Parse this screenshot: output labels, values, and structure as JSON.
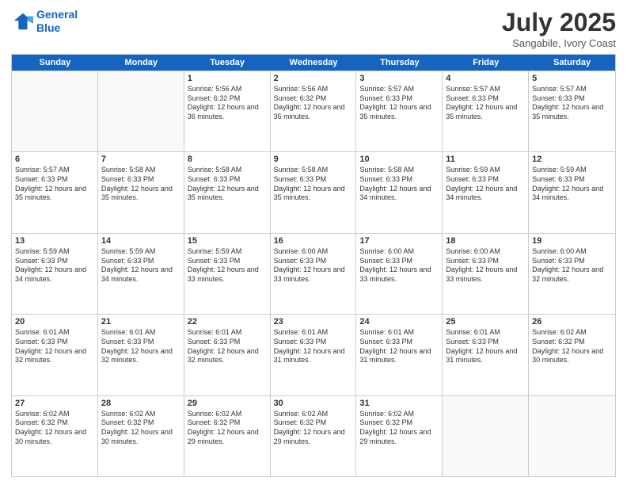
{
  "header": {
    "logo_line1": "General",
    "logo_line2": "Blue",
    "month_title": "July 2025",
    "location": "Sangabile, Ivory Coast"
  },
  "days_of_week": [
    "Sunday",
    "Monday",
    "Tuesday",
    "Wednesday",
    "Thursday",
    "Friday",
    "Saturday"
  ],
  "weeks": [
    [
      {
        "day": "",
        "empty": true
      },
      {
        "day": "",
        "empty": true
      },
      {
        "day": "1",
        "sunrise": "Sunrise: 5:56 AM",
        "sunset": "Sunset: 6:32 PM",
        "daylight": "Daylight: 12 hours and 36 minutes."
      },
      {
        "day": "2",
        "sunrise": "Sunrise: 5:56 AM",
        "sunset": "Sunset: 6:32 PM",
        "daylight": "Daylight: 12 hours and 35 minutes."
      },
      {
        "day": "3",
        "sunrise": "Sunrise: 5:57 AM",
        "sunset": "Sunset: 6:33 PM",
        "daylight": "Daylight: 12 hours and 35 minutes."
      },
      {
        "day": "4",
        "sunrise": "Sunrise: 5:57 AM",
        "sunset": "Sunset: 6:33 PM",
        "daylight": "Daylight: 12 hours and 35 minutes."
      },
      {
        "day": "5",
        "sunrise": "Sunrise: 5:57 AM",
        "sunset": "Sunset: 6:33 PM",
        "daylight": "Daylight: 12 hours and 35 minutes."
      }
    ],
    [
      {
        "day": "6",
        "sunrise": "Sunrise: 5:57 AM",
        "sunset": "Sunset: 6:33 PM",
        "daylight": "Daylight: 12 hours and 35 minutes."
      },
      {
        "day": "7",
        "sunrise": "Sunrise: 5:58 AM",
        "sunset": "Sunset: 6:33 PM",
        "daylight": "Daylight: 12 hours and 35 minutes."
      },
      {
        "day": "8",
        "sunrise": "Sunrise: 5:58 AM",
        "sunset": "Sunset: 6:33 PM",
        "daylight": "Daylight: 12 hours and 35 minutes."
      },
      {
        "day": "9",
        "sunrise": "Sunrise: 5:58 AM",
        "sunset": "Sunset: 6:33 PM",
        "daylight": "Daylight: 12 hours and 35 minutes."
      },
      {
        "day": "10",
        "sunrise": "Sunrise: 5:58 AM",
        "sunset": "Sunset: 6:33 PM",
        "daylight": "Daylight: 12 hours and 34 minutes."
      },
      {
        "day": "11",
        "sunrise": "Sunrise: 5:59 AM",
        "sunset": "Sunset: 6:33 PM",
        "daylight": "Daylight: 12 hours and 34 minutes."
      },
      {
        "day": "12",
        "sunrise": "Sunrise: 5:59 AM",
        "sunset": "Sunset: 6:33 PM",
        "daylight": "Daylight: 12 hours and 34 minutes."
      }
    ],
    [
      {
        "day": "13",
        "sunrise": "Sunrise: 5:59 AM",
        "sunset": "Sunset: 6:33 PM",
        "daylight": "Daylight: 12 hours and 34 minutes."
      },
      {
        "day": "14",
        "sunrise": "Sunrise: 5:59 AM",
        "sunset": "Sunset: 6:33 PM",
        "daylight": "Daylight: 12 hours and 34 minutes."
      },
      {
        "day": "15",
        "sunrise": "Sunrise: 5:59 AM",
        "sunset": "Sunset: 6:33 PM",
        "daylight": "Daylight: 12 hours and 33 minutes."
      },
      {
        "day": "16",
        "sunrise": "Sunrise: 6:00 AM",
        "sunset": "Sunset: 6:33 PM",
        "daylight": "Daylight: 12 hours and 33 minutes."
      },
      {
        "day": "17",
        "sunrise": "Sunrise: 6:00 AM",
        "sunset": "Sunset: 6:33 PM",
        "daylight": "Daylight: 12 hours and 33 minutes."
      },
      {
        "day": "18",
        "sunrise": "Sunrise: 6:00 AM",
        "sunset": "Sunset: 6:33 PM",
        "daylight": "Daylight: 12 hours and 33 minutes."
      },
      {
        "day": "19",
        "sunrise": "Sunrise: 6:00 AM",
        "sunset": "Sunset: 6:33 PM",
        "daylight": "Daylight: 12 hours and 32 minutes."
      }
    ],
    [
      {
        "day": "20",
        "sunrise": "Sunrise: 6:01 AM",
        "sunset": "Sunset: 6:33 PM",
        "daylight": "Daylight: 12 hours and 32 minutes."
      },
      {
        "day": "21",
        "sunrise": "Sunrise: 6:01 AM",
        "sunset": "Sunset: 6:33 PM",
        "daylight": "Daylight: 12 hours and 32 minutes."
      },
      {
        "day": "22",
        "sunrise": "Sunrise: 6:01 AM",
        "sunset": "Sunset: 6:33 PM",
        "daylight": "Daylight: 12 hours and 32 minutes."
      },
      {
        "day": "23",
        "sunrise": "Sunrise: 6:01 AM",
        "sunset": "Sunset: 6:33 PM",
        "daylight": "Daylight: 12 hours and 31 minutes."
      },
      {
        "day": "24",
        "sunrise": "Sunrise: 6:01 AM",
        "sunset": "Sunset: 6:33 PM",
        "daylight": "Daylight: 12 hours and 31 minutes."
      },
      {
        "day": "25",
        "sunrise": "Sunrise: 6:01 AM",
        "sunset": "Sunset: 6:33 PM",
        "daylight": "Daylight: 12 hours and 31 minutes."
      },
      {
        "day": "26",
        "sunrise": "Sunrise: 6:02 AM",
        "sunset": "Sunset: 6:32 PM",
        "daylight": "Daylight: 12 hours and 30 minutes."
      }
    ],
    [
      {
        "day": "27",
        "sunrise": "Sunrise: 6:02 AM",
        "sunset": "Sunset: 6:32 PM",
        "daylight": "Daylight: 12 hours and 30 minutes."
      },
      {
        "day": "28",
        "sunrise": "Sunrise: 6:02 AM",
        "sunset": "Sunset: 6:32 PM",
        "daylight": "Daylight: 12 hours and 30 minutes."
      },
      {
        "day": "29",
        "sunrise": "Sunrise: 6:02 AM",
        "sunset": "Sunset: 6:32 PM",
        "daylight": "Daylight: 12 hours and 29 minutes."
      },
      {
        "day": "30",
        "sunrise": "Sunrise: 6:02 AM",
        "sunset": "Sunset: 6:32 PM",
        "daylight": "Daylight: 12 hours and 29 minutes."
      },
      {
        "day": "31",
        "sunrise": "Sunrise: 6:02 AM",
        "sunset": "Sunset: 6:32 PM",
        "daylight": "Daylight: 12 hours and 29 minutes."
      },
      {
        "day": "",
        "empty": true
      },
      {
        "day": "",
        "empty": true
      }
    ]
  ]
}
